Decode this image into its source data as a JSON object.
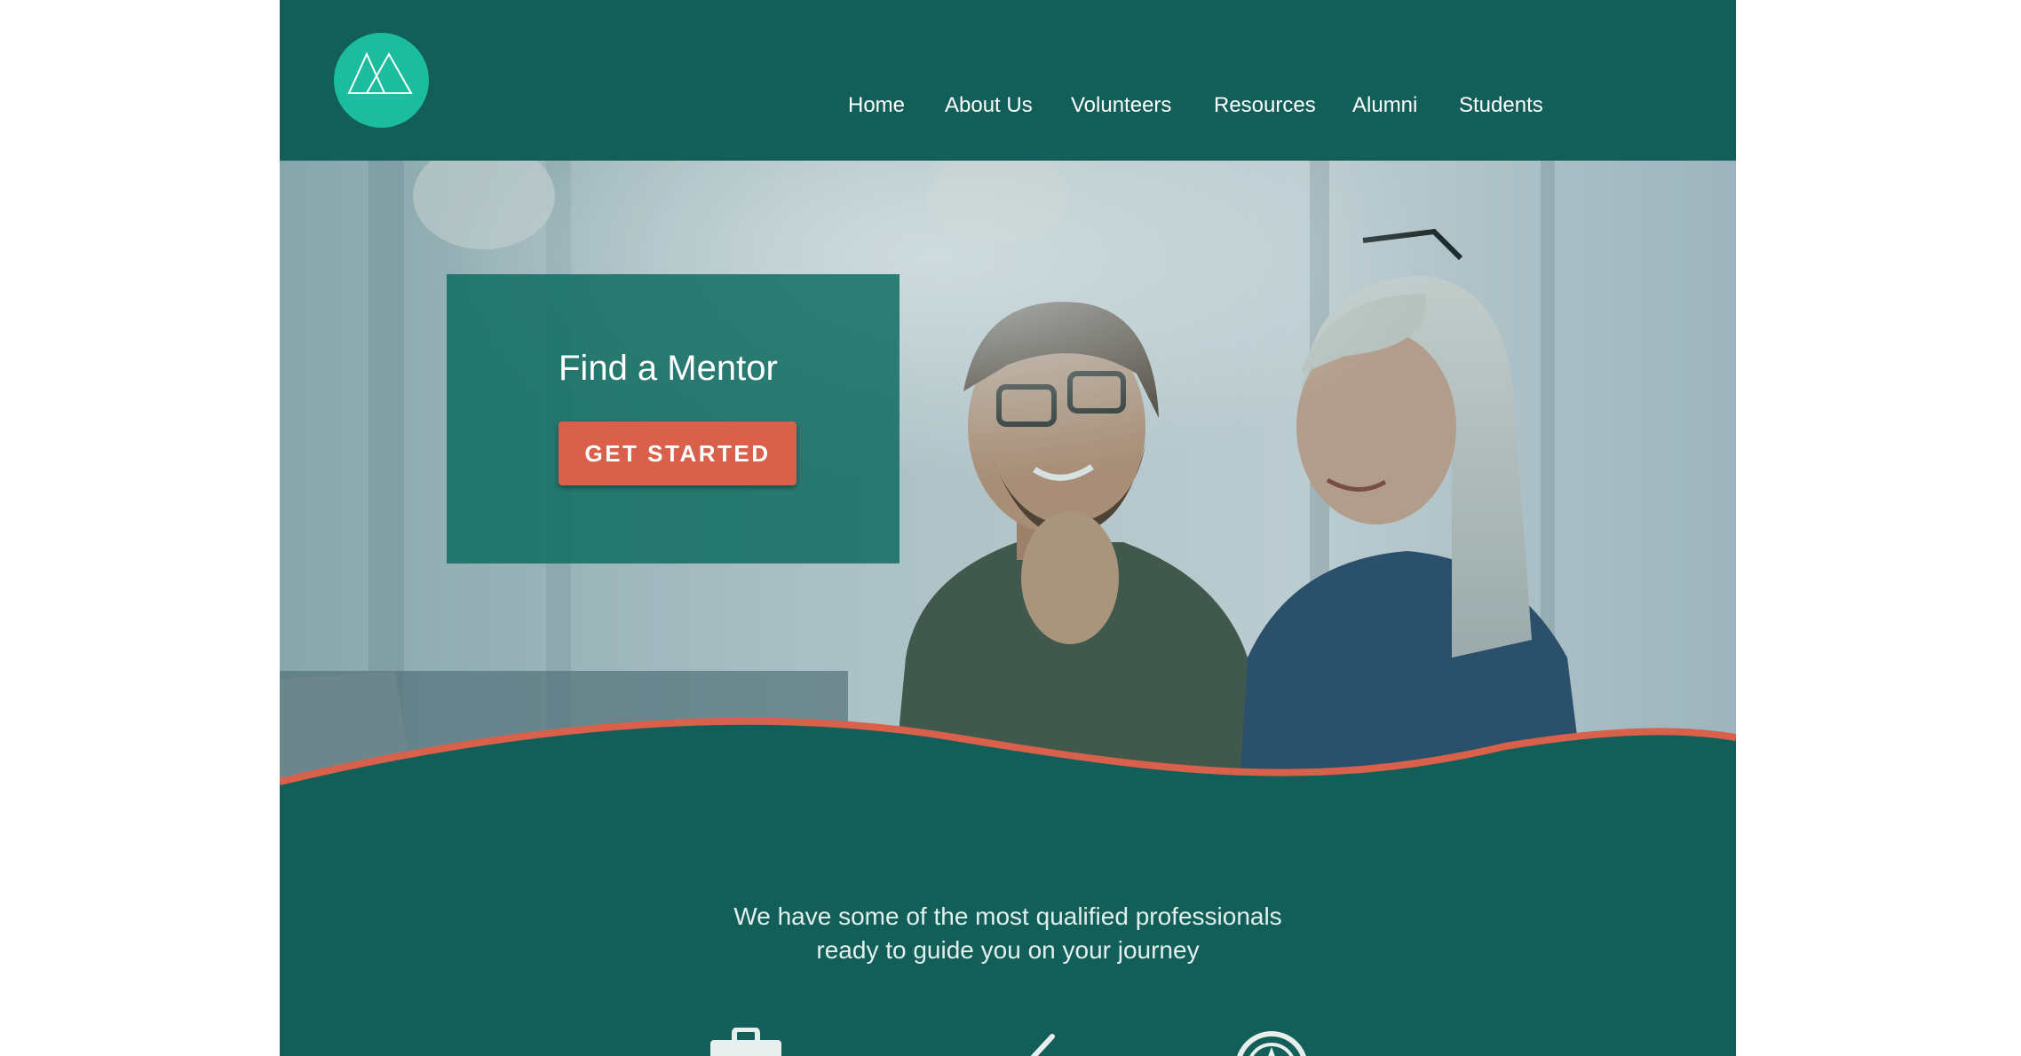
{
  "brand": {
    "logo_icon": "mountains-logo-icon",
    "colors": {
      "header": "#125e58",
      "logo": "#1cbc9e",
      "accent": "#d9604a"
    }
  },
  "nav": {
    "items": [
      {
        "label": "Home"
      },
      {
        "label": "About Us"
      },
      {
        "label": "Volunteers"
      },
      {
        "label": "Resources"
      },
      {
        "label": "Alumni"
      },
      {
        "label": "Students"
      }
    ]
  },
  "hero": {
    "title": "Find a Mentor",
    "cta_label": "GET STARTED",
    "image": "photo-two-people-mentoring-at-laptop"
  },
  "intro": {
    "line1": "We have some of the most qualified professionals",
    "line2": "ready to guide you on your journey"
  },
  "features": {
    "icons": [
      "briefcase-icon",
      "checkmark-icon",
      "compass-icon"
    ]
  }
}
